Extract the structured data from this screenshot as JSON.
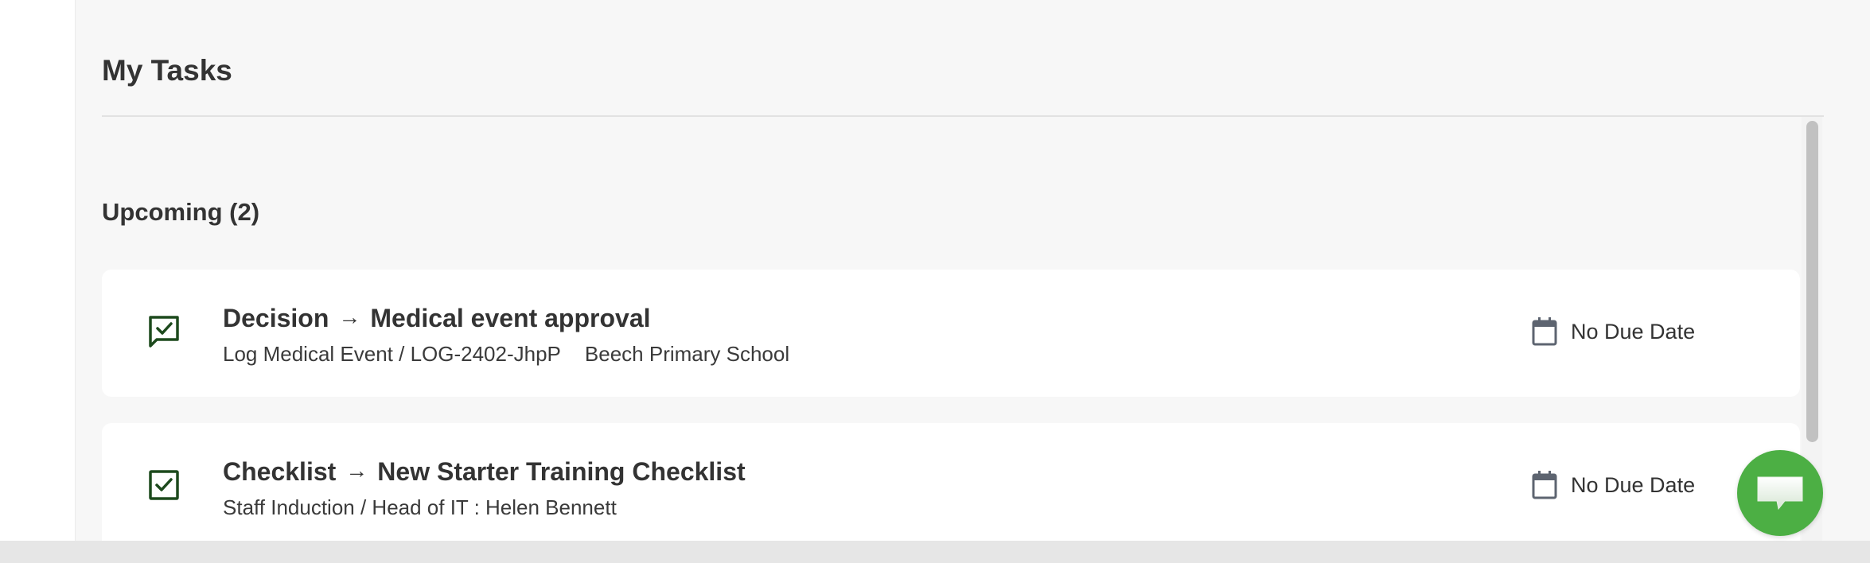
{
  "page": {
    "title": "My Tasks"
  },
  "upcoming": {
    "heading": "Upcoming (2)"
  },
  "tasks": [
    {
      "icon": "decision-icon",
      "type": "Decision",
      "name": "Medical event approval",
      "subtitle_primary": "Log Medical Event / LOG-2402-JhpP",
      "subtitle_secondary": "Beech Primary School",
      "due": "No Due Date"
    },
    {
      "icon": "checklist-icon",
      "type": "Checklist",
      "name": "New Starter Training Checklist",
      "subtitle_primary": "Staff Induction / Head of IT : Helen Bennett",
      "subtitle_secondary": "",
      "due": "No Due Date"
    }
  ],
  "colors": {
    "accent_green": "#4caf44",
    "icon_dark_green": "#1d4a1d",
    "panel_bg": "#f7f7f7",
    "card_bg": "#ffffff"
  },
  "icons": {
    "arrow": "arrow-right-icon",
    "due": "calendar-icon",
    "chat": "chat-icon"
  },
  "arrow_glyph": "→"
}
